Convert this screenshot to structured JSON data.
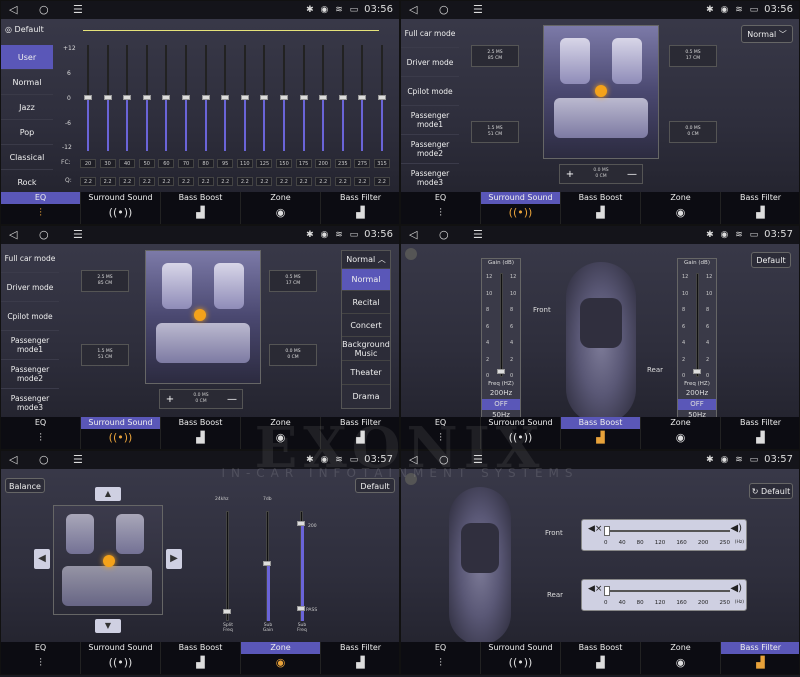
{
  "status": {
    "time1": "03:56",
    "time2": "03:56",
    "time3": "03:56",
    "time4": "03:57",
    "time5": "03:57",
    "time6": "03:57",
    "icons": "✱ ◉ ≋ ▭"
  },
  "tabs": [
    {
      "label": "EQ",
      "icon": "equalizer-icon"
    },
    {
      "label": "Surround Sound",
      "icon": "surround-icon"
    },
    {
      "label": "Bass Boost",
      "icon": "bass-boost-icon"
    },
    {
      "label": "Zone",
      "icon": "zone-icon"
    },
    {
      "label": "Bass Filter",
      "icon": "bass-filter-icon"
    }
  ],
  "eq": {
    "default_label": "Default",
    "presets": [
      "User",
      "Normal",
      "Jazz",
      "Pop",
      "Classical",
      "Rock"
    ],
    "selected": "User",
    "db_labels": [
      "+12",
      "6",
      "0",
      "-6",
      "-12"
    ],
    "fc_label": "FC:",
    "q_label": "Q:",
    "fc": [
      "20",
      "30",
      "40",
      "50",
      "60",
      "70",
      "80",
      "95",
      "110",
      "125",
      "150",
      "175",
      "200",
      "235",
      "275",
      "315"
    ],
    "q": [
      "2.2",
      "2.2",
      "2.2",
      "2.2",
      "2.2",
      "2.2",
      "2.2",
      "2.2",
      "2.2",
      "2.2",
      "2.2",
      "2.2",
      "2.2",
      "2.2",
      "2.2",
      "2.2"
    ]
  },
  "surround": {
    "modes": [
      "Full car mode",
      "Driver mode",
      "Cpilot mode",
      "Passenger mode1",
      "Passenger mode2",
      "Passenger mode3"
    ],
    "chips": [
      {
        "ms": "2.5 MS",
        "cm": "85 CM"
      },
      {
        "ms": "0.5 MS",
        "cm": "17 CM"
      },
      {
        "ms": "1.5 MS",
        "cm": "51 CM"
      },
      {
        "ms": "0.0 MS",
        "cm": "0 CM"
      }
    ],
    "center": {
      "ms": "0.0 MS",
      "cm": "0 CM"
    },
    "plus": "+",
    "minus": "—",
    "dropdown_value": "Normal",
    "dropdown_options": [
      "Normal",
      "Recital",
      "Concert",
      "Background Music",
      "Theater",
      "Drama"
    ]
  },
  "bass_boost": {
    "default_label": "Default",
    "gain_label": "Gain (dB)",
    "scale": [
      "12",
      "10",
      "8",
      "6",
      "4",
      "2",
      "0"
    ],
    "freq_label": "Freq (HZ)",
    "front_label": "Front",
    "rear_label": "Rear",
    "left": {
      "freq": "200Hz",
      "state": "OFF",
      "low": "50Hz"
    },
    "right": {
      "freq": "200Hz",
      "state": "OFF",
      "low": "50Hz"
    }
  },
  "zone": {
    "balance_label": "Balance",
    "default_label": "Default",
    "split_value": "24khz",
    "gain_value": "7db",
    "sub_value": "200",
    "pass_value": "PASS",
    "split_label": "Split Freq",
    "subgain_label": "Sub Gain",
    "subfreq_label": "Sub Freq"
  },
  "bass_filter": {
    "default_label": "Default",
    "front_label": "Front",
    "rear_label": "Rear",
    "ticks": [
      "0",
      "40",
      "80",
      "120",
      "160",
      "200",
      "250"
    ],
    "unit": "(Hz)"
  },
  "watermark": {
    "brand": "EXONIX",
    "tagline": "IN-CAR INFOTAINMENT SYSTEMS"
  }
}
